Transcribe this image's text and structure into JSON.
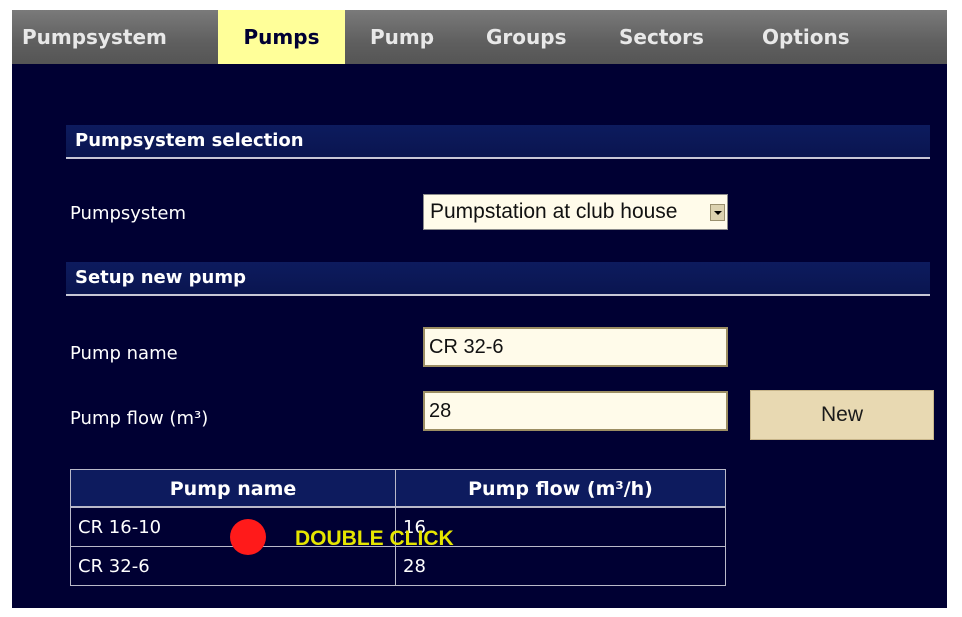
{
  "nav": {
    "tabs": [
      {
        "label": "Pumpsystem"
      },
      {
        "label": "Pumps"
      },
      {
        "label": "Pump"
      },
      {
        "label": "Groups"
      },
      {
        "label": "Sectors"
      },
      {
        "label": "Options"
      }
    ],
    "active_tab": "Pumps"
  },
  "pumpsystem_section": {
    "title": "Pumpsystem selection",
    "field_label": "Pumpsystem",
    "selected_value": "Pumpstation at club house"
  },
  "new_pump_section": {
    "title": "Setup new pump",
    "name_label": "Pump name",
    "name_value": "CR 32-6",
    "flow_label": "Pump flow (m³)",
    "flow_value": "28",
    "new_button_label": "New"
  },
  "pump_table": {
    "headers": [
      "Pump name",
      "Pump flow (m³/h)"
    ],
    "rows": [
      {
        "name": "CR 16-10",
        "flow": "16"
      },
      {
        "name": "CR 32-6",
        "flow": "28"
      }
    ]
  },
  "annotation": {
    "label": "DOUBLE CLICK",
    "dot_color": "#ff1a1a",
    "text_color": "#e6e600"
  },
  "colors": {
    "background": "#000033",
    "section_bar": "#0d1b5e",
    "active_tab": "#ffff99",
    "button": "#e8d9b2",
    "input_background": "#fffbea"
  }
}
